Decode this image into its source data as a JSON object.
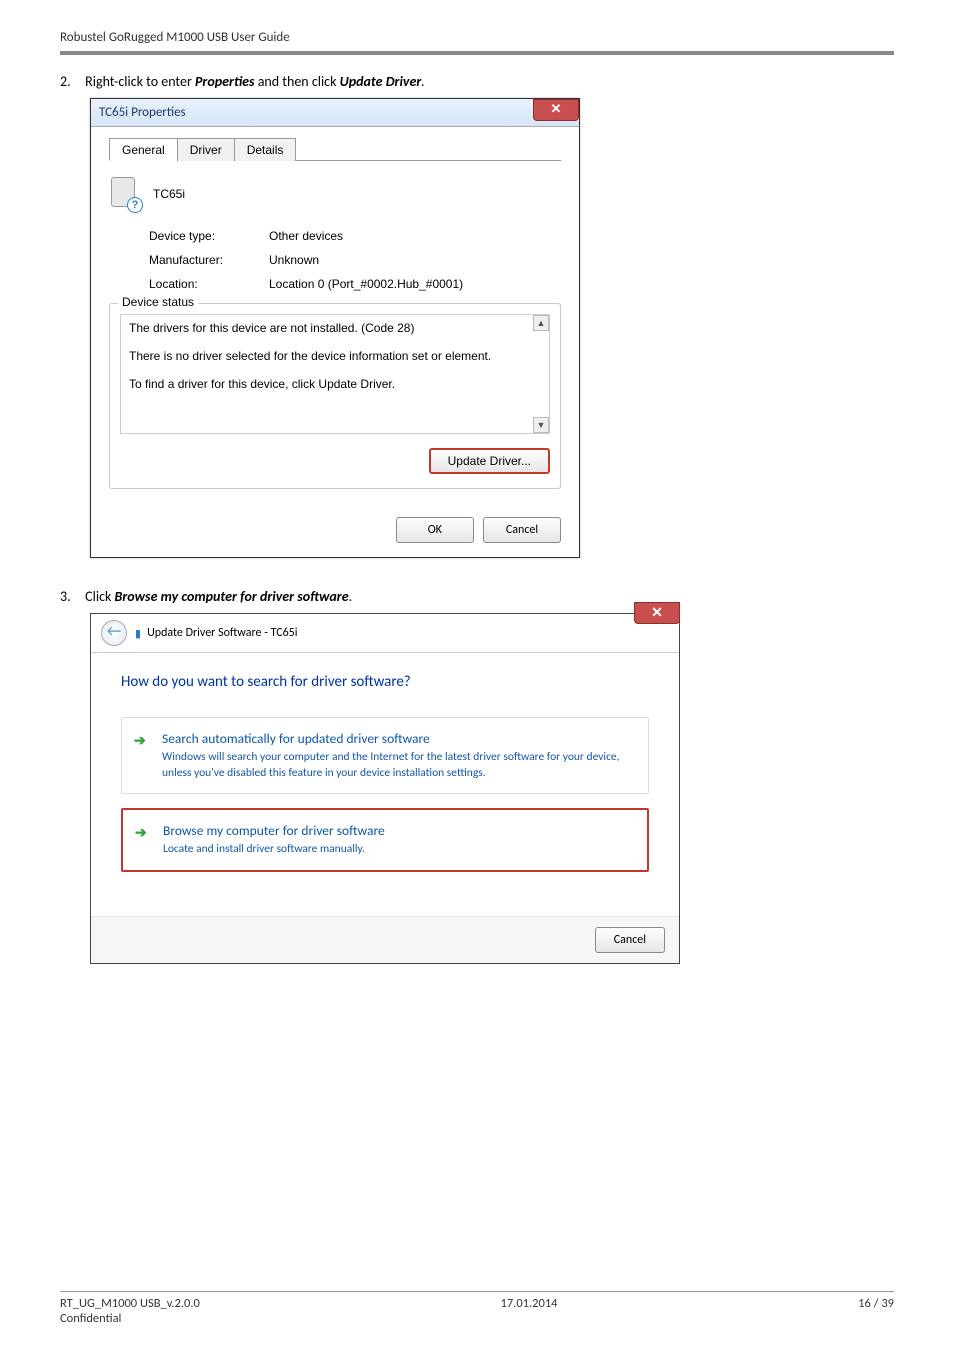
{
  "page_header": "Robustel GoRugged M1000 USB User Guide",
  "step2": {
    "num": "2.",
    "prefix": "Right-click to enter ",
    "bold1": "Properties",
    "mid": " and then click ",
    "bold2": "Update Driver",
    "end": "."
  },
  "props_dialog": {
    "title": "TC65i Properties",
    "tabs": {
      "general": "General",
      "driver": "Driver",
      "details": "Details"
    },
    "device_name": "TC65i",
    "rows": {
      "type_label": "Device type:",
      "type_value": "Other devices",
      "mfr_label": "Manufacturer:",
      "mfr_value": "Unknown",
      "loc_label": "Location:",
      "loc_value": "Location 0 (Port_#0002.Hub_#0001)"
    },
    "group_title": "Device status",
    "status_lines": {
      "l1": "The drivers for this device are not installed. (Code 28)",
      "l2": "There is no driver selected for the device information set or element.",
      "l3": "To find a driver for this device, click Update Driver."
    },
    "update_btn": "Update Driver...",
    "ok": "OK",
    "cancel": "Cancel"
  },
  "step3": {
    "num": "3.",
    "prefix": "Click ",
    "bold1": "Browse my computer for driver software",
    "end": "."
  },
  "wizard": {
    "crumb": "Update Driver Software - TC65i",
    "heading": "How do you want to search for driver software?",
    "opt1": {
      "title": "Search automatically for updated driver software",
      "desc": "Windows will search your computer and the Internet for the latest driver software for your device, unless you've disabled this feature in your device installation settings."
    },
    "opt2": {
      "title": "Browse my computer for driver software",
      "desc": "Locate and install driver software manually."
    },
    "cancel": "Cancel"
  },
  "footer": {
    "doc": "RT_UG_M1000 USB_v.2.0.0",
    "conf": "Confidential",
    "date": "17.01.2014",
    "page": "16 / 39"
  }
}
